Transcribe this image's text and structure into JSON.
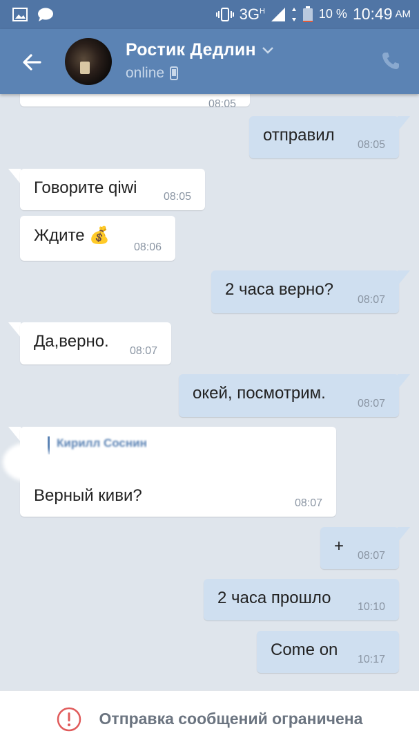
{
  "status_bar": {
    "network": "3G",
    "network_sup": "H",
    "battery_percent": "10 %",
    "time": "10:49",
    "ampm": "AM",
    "battery_level": 0.1
  },
  "header": {
    "contact_name": "Ростик Дедлин",
    "status": "online",
    "icons": [
      "back-arrow-icon",
      "chevron-down-icon",
      "mobile-icon",
      "phone-icon"
    ]
  },
  "messages": [
    {
      "dir": "in",
      "text": "",
      "time": "08:05"
    },
    {
      "dir": "out",
      "text": "отправил",
      "time": "08:05"
    },
    {
      "dir": "in",
      "text": "Говорите qiwi",
      "time": "08:05"
    },
    {
      "dir": "in",
      "text": "Ждите 💰",
      "time": "08:06"
    },
    {
      "dir": "out",
      "text": "2 часа верно?",
      "time": "08:07"
    },
    {
      "dir": "in",
      "text": "Да,верно.",
      "time": "08:07"
    },
    {
      "dir": "out",
      "text": "окей, посмотрим.",
      "time": "08:07"
    },
    {
      "dir": "in",
      "reply_to": "Кирилл Соснин",
      "text": "Верный киви?",
      "time": "08:07"
    },
    {
      "dir": "out",
      "text": "+",
      "time": "08:07"
    },
    {
      "dir": "out",
      "text": "2 часа прошло",
      "time": "10:10"
    },
    {
      "dir": "out",
      "text": "Come on",
      "time": "10:17"
    }
  ],
  "footer": {
    "notice": "Отправка сообщений ограничена",
    "icon": "alert-circle-icon"
  },
  "colors": {
    "header": "#5b83b4",
    "status_bar": "#5075a5",
    "chat_bg": "#dfe5ec",
    "outgoing": "#cfdff0",
    "incoming": "#ffffff",
    "alert": "#e05a5a"
  }
}
